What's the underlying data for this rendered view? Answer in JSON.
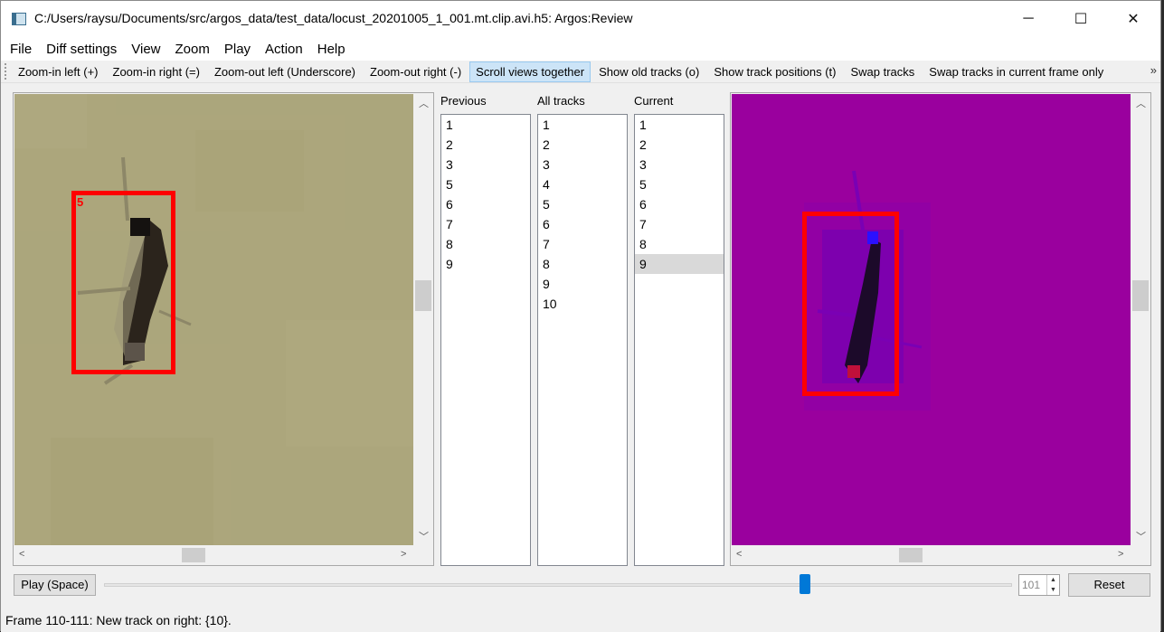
{
  "window": {
    "title": "C:/Users/raysu/Documents/src/argos_data/test_data/locust_20201005_1_001.mt.clip.avi.h5: Argos:Review",
    "minimize": "─",
    "maximize": "☐",
    "close": "✕"
  },
  "menu": [
    {
      "label": "File"
    },
    {
      "label": "Diff settings"
    },
    {
      "label": "View"
    },
    {
      "label": "Zoom"
    },
    {
      "label": "Play"
    },
    {
      "label": "Action"
    },
    {
      "label": "Help"
    }
  ],
  "toolbar": {
    "items": [
      {
        "label": "Zoom-in left (+)",
        "checked": false
      },
      {
        "label": "Zoom-in right (=)",
        "checked": false
      },
      {
        "label": "Zoom-out left (Underscore)",
        "checked": false
      },
      {
        "label": "Zoom-out right (-)",
        "checked": false
      },
      {
        "label": "Scroll views together",
        "checked": true
      },
      {
        "label": "Show old tracks (o)",
        "checked": false
      },
      {
        "label": "Show track positions (t)",
        "checked": false
      },
      {
        "label": "Swap tracks",
        "checked": false
      },
      {
        "label": "Swap tracks in current frame only",
        "checked": false
      }
    ],
    "more": "»"
  },
  "left_view": {
    "track_label": "5",
    "background_color": "#aca67c",
    "box_color": "#ff0000"
  },
  "right_view": {
    "background_color": "#9a009e",
    "box_color": "#ff0000"
  },
  "lists": {
    "previous": {
      "label": "Previous",
      "items": [
        "1",
        "2",
        "3",
        "5",
        "6",
        "7",
        "8",
        "9"
      ]
    },
    "all_tracks": {
      "label": "All tracks",
      "items": [
        "1",
        "2",
        "3",
        "4",
        "5",
        "6",
        "7",
        "8",
        "9",
        "10"
      ]
    },
    "current": {
      "label": "Current",
      "items": [
        "1",
        "2",
        "3",
        "5",
        "6",
        "7",
        "8",
        "9"
      ],
      "selected": "9"
    }
  },
  "controls": {
    "play_label": "Play (Space)",
    "frame_value": "101",
    "reset_label": "Reset"
  },
  "status": {
    "text": "Frame 110-111: New track on right: {10}."
  }
}
